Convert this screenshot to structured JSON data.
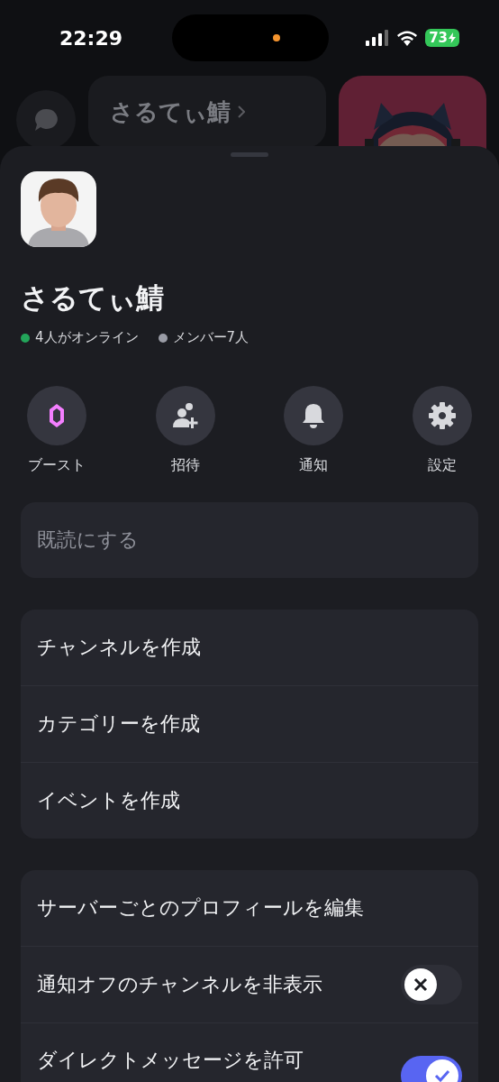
{
  "status_bar": {
    "time": "22:29",
    "battery": "73"
  },
  "background": {
    "server_name": "さるてぃ鯖",
    "banner": {
      "kind": "picture"
    }
  },
  "sheet": {
    "avatar": {
      "kind": "picture"
    },
    "server_name": "さるてぃ鯖",
    "stats": [
      {
        "label": "4人がオンライン",
        "color": "#23a55a"
      },
      {
        "label": "メンバー7人",
        "color": "#9a9ca6"
      }
    ],
    "actions": [
      {
        "kind": "boost",
        "label": "ブースト"
      },
      {
        "kind": "invite",
        "label": "招待"
      },
      {
        "kind": "notify",
        "label": "通知"
      },
      {
        "kind": "settings",
        "label": "設定"
      }
    ],
    "groups": [
      [
        {
          "kind": "link",
          "label": "既読にする",
          "disabled": true
        }
      ],
      [
        {
          "kind": "link",
          "label": "チャンネルを作成",
          "disabled": false
        },
        {
          "kind": "link",
          "label": "カテゴリーを作成",
          "disabled": false
        },
        {
          "kind": "link",
          "label": "イベントを作成",
          "disabled": false
        }
      ],
      [
        {
          "kind": "link",
          "label": "サーバーごとのプロフィールを編集",
          "disabled": false
        },
        {
          "kind": "toggle",
          "label": "通知オフのチャンネルを非表示",
          "on": false
        },
        {
          "kind": "toggle",
          "label": "ダイレクトメッセージを許可",
          "on": true
        }
      ]
    ]
  }
}
